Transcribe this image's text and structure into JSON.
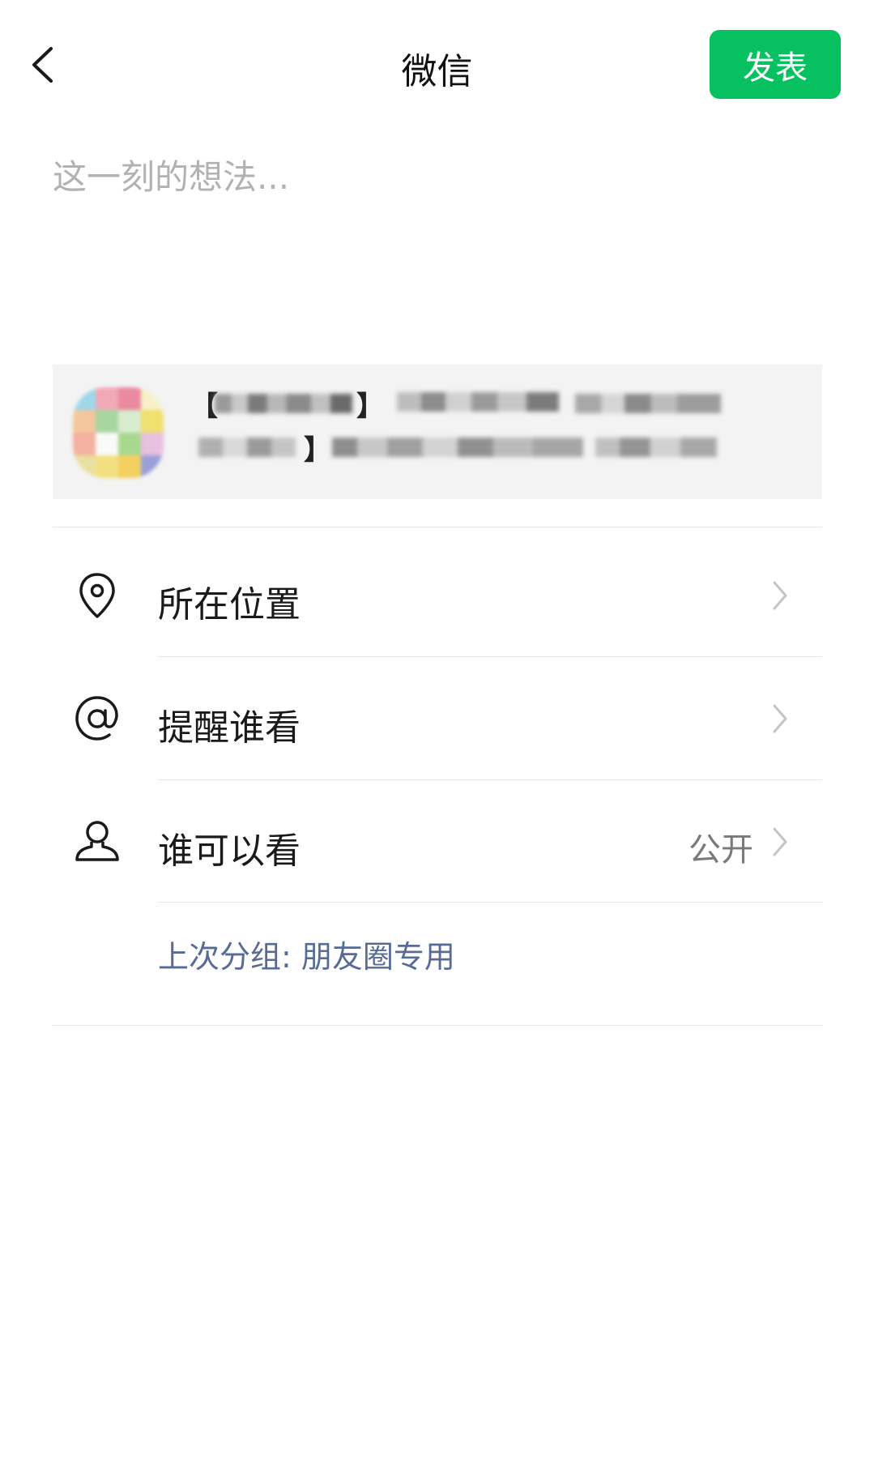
{
  "header": {
    "title": "微信",
    "publish_label": "发表"
  },
  "composer": {
    "placeholder": "这一刻的想法...",
    "value": ""
  },
  "link_card": {
    "bracket_open": "【",
    "bracket_close": "】",
    "bracket_close2": "】"
  },
  "rows": [
    {
      "label": "所在位置",
      "value": ""
    },
    {
      "label": "提醒谁看",
      "value": ""
    },
    {
      "label": "谁可以看",
      "value": "公开"
    }
  ],
  "last_group": "上次分组: 朋友圈专用",
  "colors": {
    "accent": "#07c160",
    "link": "#576b95"
  }
}
